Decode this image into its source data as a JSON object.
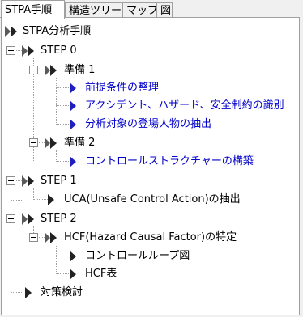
{
  "tabs": [
    {
      "label": "STPA手順",
      "active": true
    },
    {
      "label": "構造ツリー",
      "active": false
    },
    {
      "label": "マップ",
      "active": false
    },
    {
      "label": "図",
      "active": false
    }
  ],
  "tree": {
    "root": "STPA分析手順",
    "step0": {
      "label": "STEP 0",
      "prep1": {
        "label": "準備 1",
        "items": [
          "前提条件の整理",
          "アクシデント、ハザード、安全制約の識別",
          "分析対象の登場人物の抽出"
        ]
      },
      "prep2": {
        "label": "準備 2",
        "items": [
          "コントロールストラクチャーの構築"
        ]
      }
    },
    "step1": {
      "label": "STEP 1",
      "items": [
        "UCA(Unsafe Control Action)の抽出"
      ]
    },
    "step2": {
      "label": "STEP 2",
      "hcf": {
        "label": "HCF(Hazard Causal Factor)の特定",
        "items": [
          "コントロールループ図",
          "HCF表"
        ]
      }
    },
    "countermeasure": "対策検討"
  },
  "colors": {
    "link_text": "#0000cc",
    "icon_gray": "#5a5a5a",
    "icon_dark": "#222222",
    "icon_blue": "#1f1fbf"
  }
}
